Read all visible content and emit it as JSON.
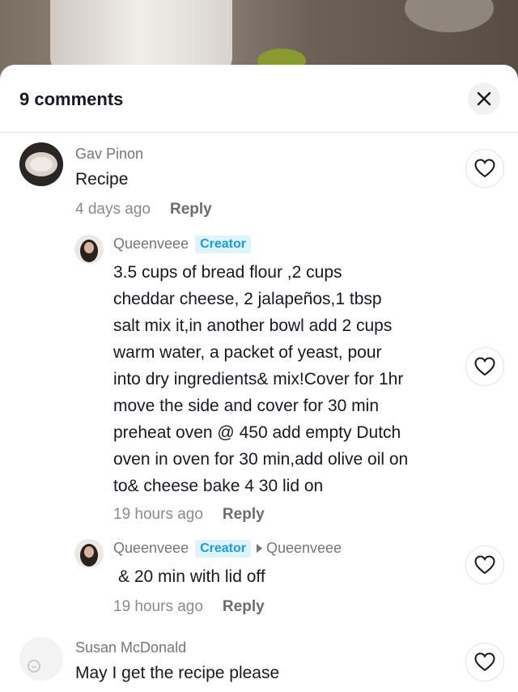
{
  "header": {
    "title": "9 comments",
    "close_icon": "close-icon"
  },
  "comments": [
    {
      "username": "Gav Pinon",
      "text": "Recipe",
      "time": "4 days ago",
      "reply_label": "Reply"
    },
    {
      "username": "Queenveee",
      "badge": "Creator",
      "lines": [
        "3.5 cups of bread flour ,2 cups",
        "cheddar cheese, 2 jalapeños,1 tbsp",
        "salt mix it,in another bowl add 2 cups",
        "warm water, a packet of yeast, pour",
        "into dry ingredients& mix!Cover for 1hr",
        "move the side and cover for 30 min",
        "preheat oven @ 450 add empty Dutch",
        "oven in oven for 30 min,add olive oil on",
        "to& cheese bake 4 30 lid on"
      ],
      "time": "19 hours ago",
      "reply_label": "Reply"
    },
    {
      "username": "Queenveee",
      "badge": "Creator",
      "reply_to": "Queenveee",
      "text": "& 20 min with lid off",
      "time": "19 hours ago",
      "reply_label": "Reply"
    },
    {
      "username": "Susan McDonald",
      "text": "May I get the recipe please"
    }
  ],
  "colors": {
    "accent": "#1b9be0",
    "badge_bg": "#dff3fd",
    "text": "#161823",
    "muted": "#8a8a8e"
  }
}
